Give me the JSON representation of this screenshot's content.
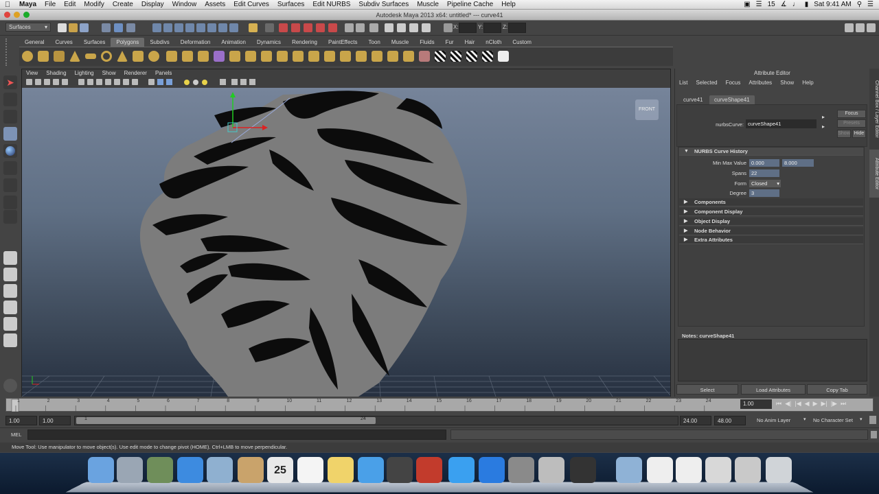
{
  "menubar": {
    "app": "Maya",
    "items": [
      "File",
      "Edit",
      "Modify",
      "Create",
      "Display",
      "Window",
      "Assets",
      "Edit Curves",
      "Surfaces",
      "Edit NURBS",
      "Subdiv Surfaces",
      "Muscle",
      "Pipeline Cache",
      "Help"
    ],
    "badge": "15",
    "clock": "Sat 9:41 AM"
  },
  "window": {
    "title": "Autodesk Maya 2013 x64: untitled*   ---   curve41"
  },
  "statusline": {
    "menuset": "Surfaces",
    "x_label": "X:",
    "y_label": "Y:",
    "z_label": "Z:"
  },
  "shelf": {
    "tabs": [
      "General",
      "Curves",
      "Surfaces",
      "Polygons",
      "Subdivs",
      "Deformation",
      "Animation",
      "Dynamics",
      "Rendering",
      "PaintEffects",
      "Toon",
      "Muscle",
      "Fluids",
      "Fur",
      "Hair",
      "nCloth",
      "Custom"
    ],
    "active": "Polygons"
  },
  "viewport": {
    "menu": [
      "View",
      "Shading",
      "Lighting",
      "Show",
      "Renderer",
      "Panels"
    ],
    "camera_label": "FRONT"
  },
  "attribute_editor": {
    "title": "Attribute Editor",
    "menu": [
      "List",
      "Selected",
      "Focus",
      "Attributes",
      "Show",
      "Help"
    ],
    "tabs": [
      "curve41",
      "curveShape41"
    ],
    "active_tab": "curveShape41",
    "node_type_label": "nurbsCurve:",
    "node_name": "curveShape41",
    "buttons": {
      "focus": "Focus",
      "presets": "Presets",
      "show": "Show",
      "hide": "Hide"
    },
    "history_section": "NURBS Curve History",
    "fields": {
      "min_max_label": "Min Max Value",
      "min_value": "0.000",
      "max_value": "8.000",
      "spans_label": "Spans",
      "spans_value": "22",
      "form_label": "Form",
      "form_value": "Closed",
      "degree_label": "Degree",
      "degree_value": "3"
    },
    "sections": [
      "Components",
      "Component Display",
      "Object Display",
      "Node Behavior",
      "Extra Attributes"
    ],
    "notes_label": "Notes:  curveShape41",
    "bottom_buttons": [
      "Select",
      "Load Attributes",
      "Copy Tab"
    ]
  },
  "side_tabs": [
    "Channel Box / Layer Editor",
    "Attribute Editor"
  ],
  "time_slider": {
    "ticks": [
      "1",
      "2",
      "3",
      "4",
      "5",
      "6",
      "7",
      "8",
      "9",
      "10",
      "11",
      "12",
      "13",
      "14",
      "15",
      "16",
      "17",
      "18",
      "19",
      "20",
      "21",
      "22",
      "23",
      "24"
    ],
    "current": "1.00"
  },
  "range_slider": {
    "start": "1.00",
    "playback_start": "1.00",
    "range_start_label": "1",
    "range_end_label": "24",
    "playback_end": "24.00",
    "end": "48.00",
    "anim_layer": "No Anim Layer",
    "character_set": "No Character Set"
  },
  "command_line": {
    "label": "MEL"
  },
  "help_line": "Move Tool: Use manipulator to move object(s). Use edit mode to change pivot (HOME).  Ctrl+LMB to move perpendicular.",
  "dock": {
    "icons": [
      "finder-icon",
      "launchpad-icon",
      "image-capture-icon",
      "safari-icon",
      "preview-icon",
      "mail-icon",
      "calendar-icon",
      "notes-icon",
      "stickies-icon",
      "messages-icon",
      "facetime-icon",
      "photo-booth-icon",
      "itunes-icon",
      "app-store-icon",
      "system-preferences-icon",
      "screenshot-icon",
      "maya-icon",
      "folder-icon",
      "lion-image-icon",
      "document-icon",
      "document-icon-2",
      "preview-doc-icon",
      "trash-icon"
    ],
    "calendar_day": "25"
  },
  "colors": {
    "accent_field": "#5f6f86",
    "viewport_top": "#76849a",
    "viewport_bottom": "#263040",
    "model": "#7c7c7c"
  }
}
